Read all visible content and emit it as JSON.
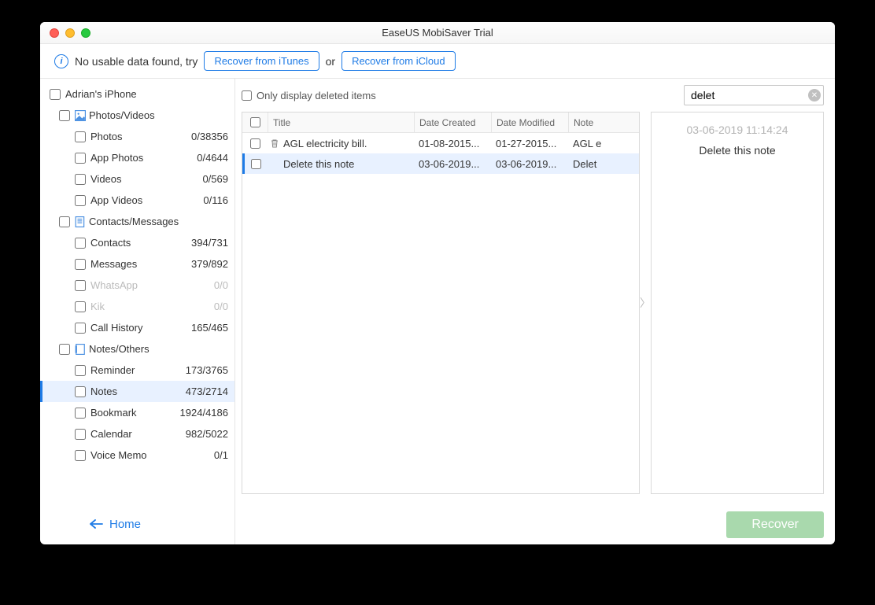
{
  "window_title": "EaseUS MobiSaver Trial",
  "toolbar": {
    "message": "No usable data found, try",
    "btn_itunes": "Recover from iTunes",
    "or": "or",
    "btn_icloud": "Recover from iCloud"
  },
  "sidebar": {
    "device": "Adrian's iPhone",
    "groups": [
      {
        "label": "Photos/Videos",
        "items": [
          {
            "label": "Photos",
            "count": "0/38356"
          },
          {
            "label": "App Photos",
            "count": "0/4644"
          },
          {
            "label": "Videos",
            "count": "0/569"
          },
          {
            "label": "App Videos",
            "count": "0/116"
          }
        ]
      },
      {
        "label": "Contacts/Messages",
        "items": [
          {
            "label": "Contacts",
            "count": "394/731"
          },
          {
            "label": "Messages",
            "count": "379/892"
          },
          {
            "label": "WhatsApp",
            "count": "0/0",
            "dim": true
          },
          {
            "label": "Kik",
            "count": "0/0",
            "dim": true
          },
          {
            "label": "Call History",
            "count": "165/465"
          }
        ]
      },
      {
        "label": "Notes/Others",
        "items": [
          {
            "label": "Reminder",
            "count": "173/3765"
          },
          {
            "label": "Notes",
            "count": "473/2714",
            "selected": true
          },
          {
            "label": "Bookmark",
            "count": "1924/4186"
          },
          {
            "label": "Calendar",
            "count": "982/5022"
          },
          {
            "label": "Voice Memo",
            "count": "0/1"
          }
        ]
      }
    ],
    "home": "Home"
  },
  "filter": {
    "only_deleted": "Only display deleted items",
    "search_value": "delet"
  },
  "list": {
    "headers": {
      "title": "Title",
      "created": "Date Created",
      "modified": "Date Modified",
      "note": "Note"
    },
    "rows": [
      {
        "deleted": true,
        "title": "AGL electricity bill.",
        "created": "01-08-2015...",
        "modified": "01-27-2015...",
        "note": "AGL e"
      },
      {
        "deleted": false,
        "selected": true,
        "title": "Delete this note",
        "created": "03-06-2019...",
        "modified": "03-06-2019...",
        "note": "Delet"
      }
    ]
  },
  "preview": {
    "timestamp": "03-06-2019 11:14:24",
    "body": "Delete this note"
  },
  "footer": {
    "recover": "Recover"
  }
}
